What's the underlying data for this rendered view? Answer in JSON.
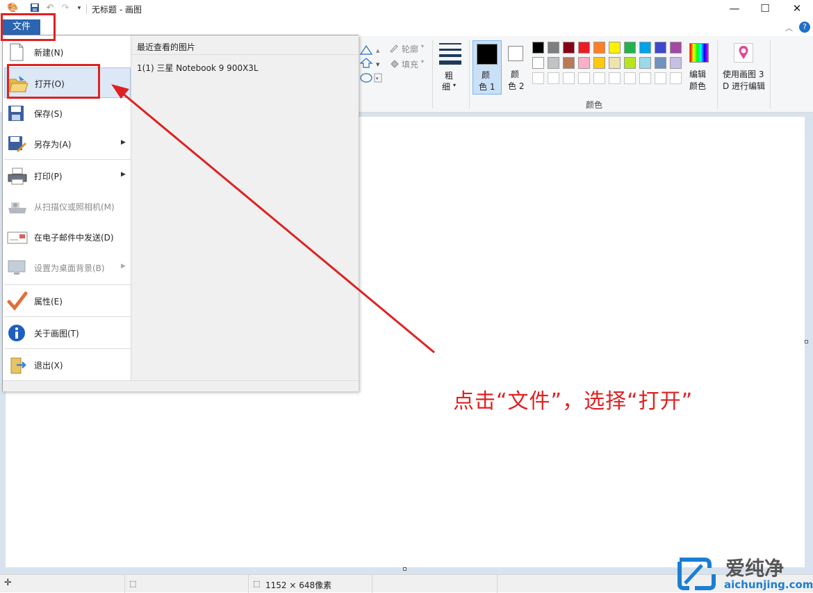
{
  "window": {
    "title": "无标题 - 画图"
  },
  "file_tab": {
    "label": "文件"
  },
  "file_menu": {
    "items": [
      {
        "label": "新建(N)"
      },
      {
        "label": "打开(O)"
      },
      {
        "label": "保存(S)"
      },
      {
        "label": "另存为(A)"
      },
      {
        "label": "打印(P)"
      },
      {
        "label": "从扫描仪或照相机(M)"
      },
      {
        "label": "在电子邮件中发送(D)"
      },
      {
        "label": "设置为桌面背景(B)"
      },
      {
        "label": "属性(E)"
      },
      {
        "label": "关于画图(T)"
      },
      {
        "label": "退出(X)"
      }
    ],
    "recent_title": "最近查看的图片",
    "recent_items": [
      {
        "label": "1(1)  三星 Notebook 9 900X3L"
      }
    ]
  },
  "ribbon": {
    "outline_label": "轮廓",
    "fill_label": "填充",
    "size_label_1": "粗",
    "size_label_2": "细",
    "color1_label_1": "颜",
    "color1_label_2": "色 1",
    "color2_label_1": "颜",
    "color2_label_2": "色 2",
    "edit_colors_1": "编辑",
    "edit_colors_2": "颜色",
    "paint3d_1": "使用画图 3",
    "paint3d_2": "D 进行编辑",
    "colors_group": "颜色",
    "palette": [
      "#000000",
      "#7f7f7f",
      "#880015",
      "#ed1c24",
      "#ff7f27",
      "#fff200",
      "#22b14c",
      "#00a2e8",
      "#3f48cc",
      "#a349a4",
      "#ffffff",
      "#c3c3c3",
      "#b97a57",
      "#ffaec9",
      "#ffc90e",
      "#efe4b0",
      "#b5e61d",
      "#99d9ea",
      "#7092be",
      "#c8bfe7"
    ]
  },
  "statusbar": {
    "dimensions": "1152 × 648像素"
  },
  "annotation": {
    "text": "点击“文件”，选择“打开”"
  },
  "watermark": {
    "brand": "爱纯净",
    "url": "aichunjing.com"
  },
  "colors": {
    "accent": "#2b64b0",
    "annotation_red": "#e02020",
    "watermark_blue": "#1a7fd4"
  }
}
